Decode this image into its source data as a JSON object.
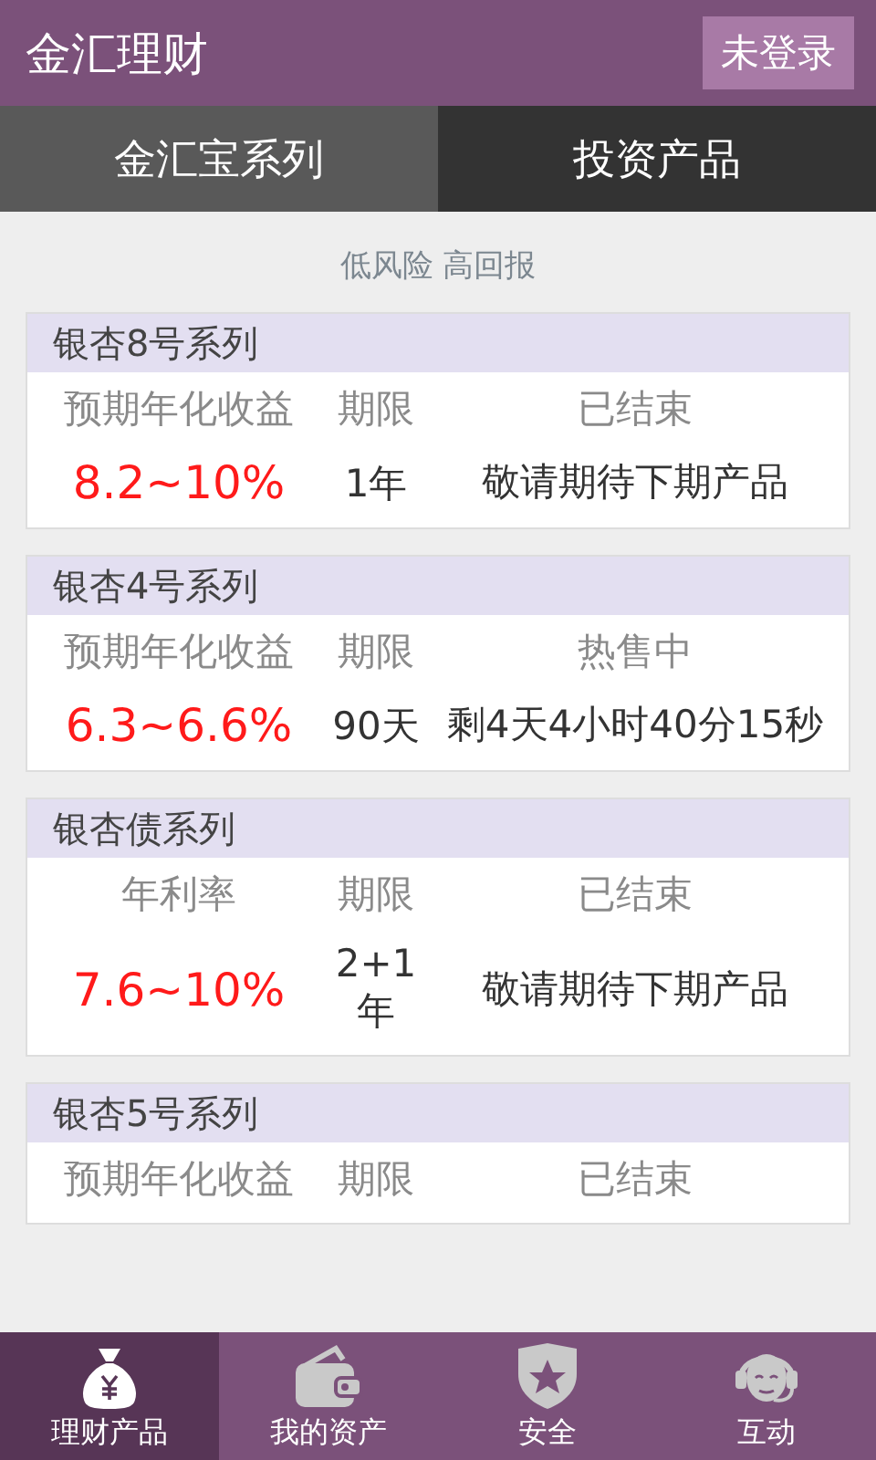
{
  "app_bar": {
    "title": "金汇理财",
    "login_button": "未登录"
  },
  "tabs": [
    {
      "label": "金汇宝系列",
      "selected": false
    },
    {
      "label": "投资产品",
      "selected": true
    }
  ],
  "tagline": "低风险 高回报",
  "products": [
    {
      "name": "银杏8号系列",
      "rate_label": "预期年化收益",
      "term_label": "期限",
      "status": "已结束",
      "rate": "8.2~10%",
      "term": "1年",
      "note": "敬请期待下期产品"
    },
    {
      "name": "银杏4号系列",
      "rate_label": "预期年化收益",
      "term_label": "期限",
      "status": "热售中",
      "rate": "6.3~6.6%",
      "term": "90天",
      "note": "剩4天4小时40分15秒"
    },
    {
      "name": "银杏债系列",
      "rate_label": "年利率",
      "term_label": "期限",
      "status": "已结束",
      "rate": "7.6~10%",
      "term": "2+1年",
      "note": "敬请期待下期产品"
    },
    {
      "name": "银杏5号系列",
      "rate_label": "预期年化收益",
      "term_label": "期限",
      "status": "已结束"
    }
  ],
  "bottom_nav": [
    {
      "label": "理财产品",
      "kind": "moneybag",
      "selected": true
    },
    {
      "label": "我的资产",
      "kind": "wallet",
      "selected": false
    },
    {
      "label": "安全",
      "kind": "shield",
      "selected": false
    },
    {
      "label": "互动",
      "kind": "support",
      "selected": false
    }
  ]
}
